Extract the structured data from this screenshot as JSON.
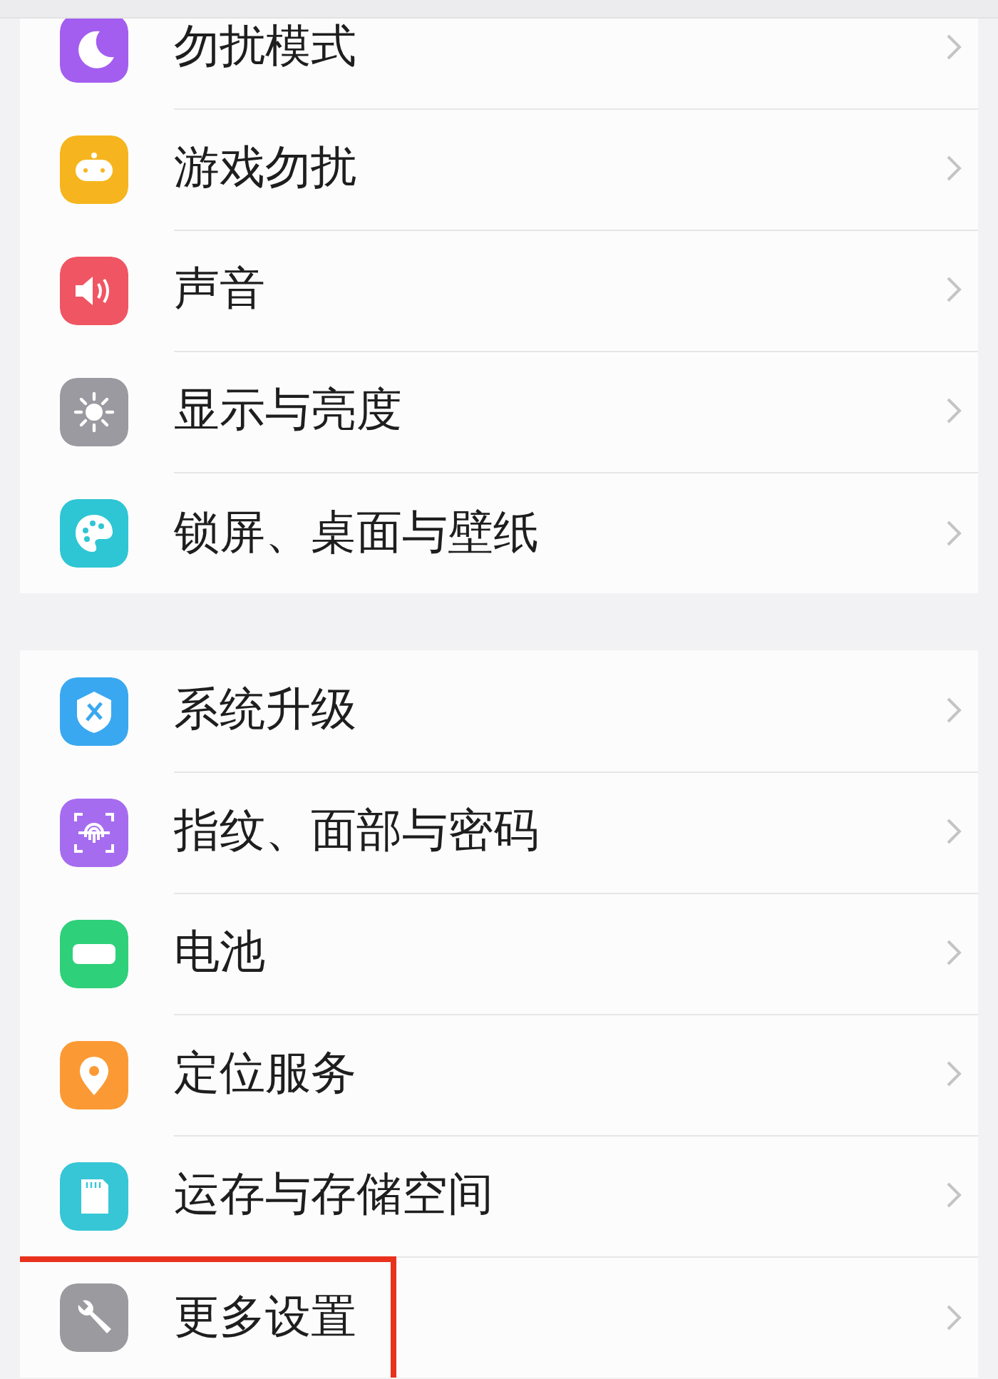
{
  "groups": [
    {
      "items": [
        {
          "label": "勿扰模式",
          "highlighted": false
        },
        {
          "label": "游戏勿扰",
          "highlighted": false
        },
        {
          "label": "声音",
          "highlighted": false
        },
        {
          "label": "显示与亮度",
          "highlighted": false
        },
        {
          "label": "锁屏、桌面与壁纸",
          "highlighted": false
        }
      ]
    },
    {
      "items": [
        {
          "label": "系统升级",
          "highlighted": false
        },
        {
          "label": "指纹、面部与密码",
          "highlighted": false
        },
        {
          "label": "电池",
          "highlighted": false
        },
        {
          "label": "定位服务",
          "highlighted": false
        },
        {
          "label": "运存与存储空间",
          "highlighted": false
        },
        {
          "label": "更多设置",
          "highlighted": true
        }
      ]
    }
  ]
}
